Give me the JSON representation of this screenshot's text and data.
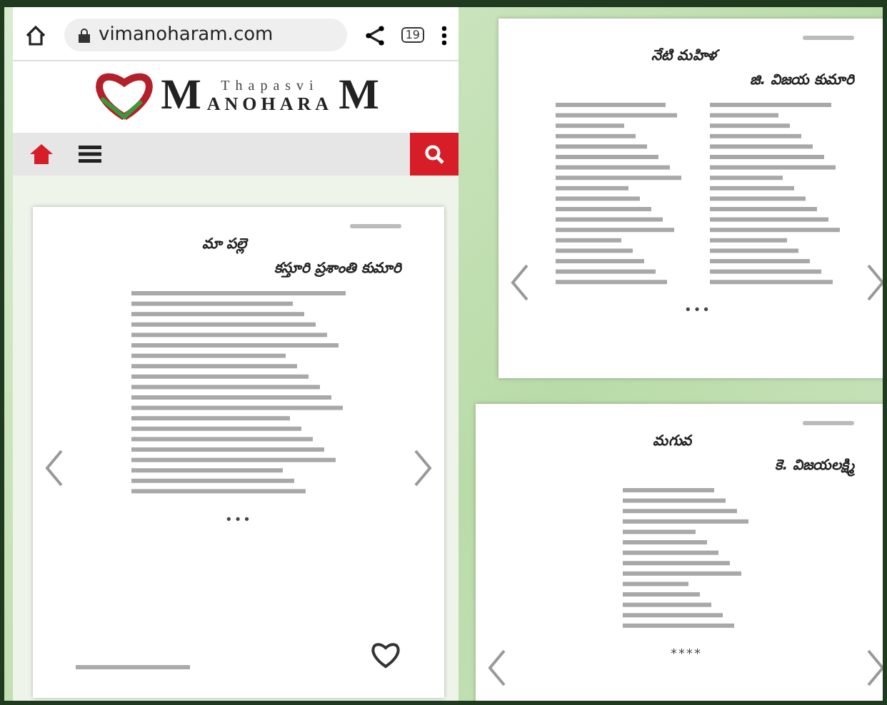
{
  "browser": {
    "url": "vimanoharam.com",
    "tab_count": "19"
  },
  "logo": {
    "small": "Thapasvi",
    "first": "M",
    "middle": "ANOHARA",
    "last": "M"
  },
  "poems": [
    {
      "kind": "single",
      "title": "మా పల్లె",
      "author": "కస్తూరి ప్రశాంతి కుమారి",
      "separator": "•••",
      "footer": true
    },
    {
      "kind": "double",
      "title": "నేటి మహిళ",
      "author": "జి. విజయ కుమారి",
      "separator": "•••",
      "footer": false
    },
    {
      "kind": "single",
      "title": "మగువ",
      "author": "కె. విజయలక్ష్మి",
      "separator": "****",
      "footer": false
    }
  ]
}
